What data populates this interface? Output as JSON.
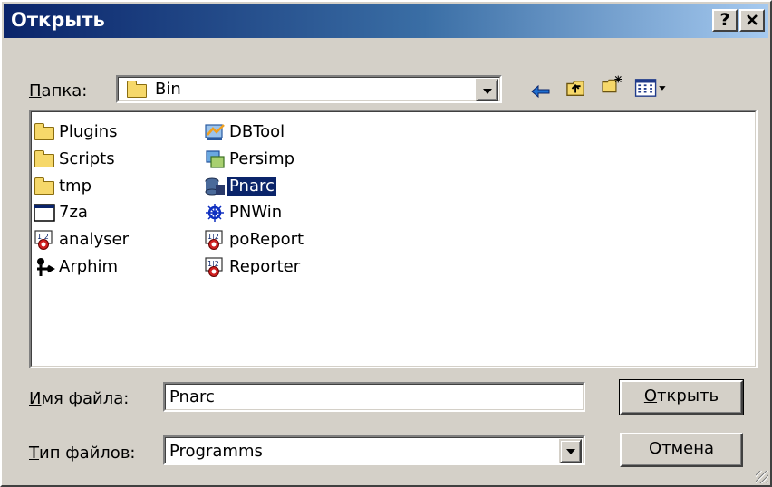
{
  "dialog": {
    "title": "Открыть",
    "help_button": "?",
    "close_button": "X"
  },
  "folder": {
    "label_mnemonic": "П",
    "label_rest": "апка:",
    "current": "Bin"
  },
  "toolbar": {
    "back": "back-arrow-icon",
    "up": "up-folder-icon",
    "new_folder": "new-folder-icon",
    "view_menu": "view-menu-icon"
  },
  "files": [
    {
      "name": "Plugins",
      "icon": "folder-icon"
    },
    {
      "name": "Scripts",
      "icon": "folder-icon"
    },
    {
      "name": "tmp",
      "icon": "folder-icon"
    },
    {
      "name": "7za",
      "icon": "console-app-icon"
    },
    {
      "name": "analyser",
      "icon": "report-app-icon"
    },
    {
      "name": "Arphim",
      "icon": "arphim-app-icon"
    },
    {
      "name": "DBTool",
      "icon": "dbtool-app-icon"
    },
    {
      "name": "Persimp",
      "icon": "persimp-app-icon"
    },
    {
      "name": "Pnarc",
      "icon": "pnarc-app-icon",
      "selected": true
    },
    {
      "name": "PNWin",
      "icon": "pnwin-app-icon"
    },
    {
      "name": "poReport",
      "icon": "report-app-icon"
    },
    {
      "name": "Reporter",
      "icon": "report-app-icon"
    }
  ],
  "filename": {
    "label_mnemonic": "И",
    "label_rest": "мя файла:",
    "value": "Pnarc"
  },
  "filetype": {
    "label_mnemonic": "Т",
    "label_rest": "ип файлов:",
    "value": "Programms"
  },
  "buttons": {
    "open_mnemonic": "О",
    "open_rest": "ткрыть",
    "cancel": "Отмена"
  },
  "colors": {
    "title_start": "#0a246a",
    "title_end": "#a6caf0",
    "selection": "#0a246a",
    "face": "#d4d0c8"
  }
}
